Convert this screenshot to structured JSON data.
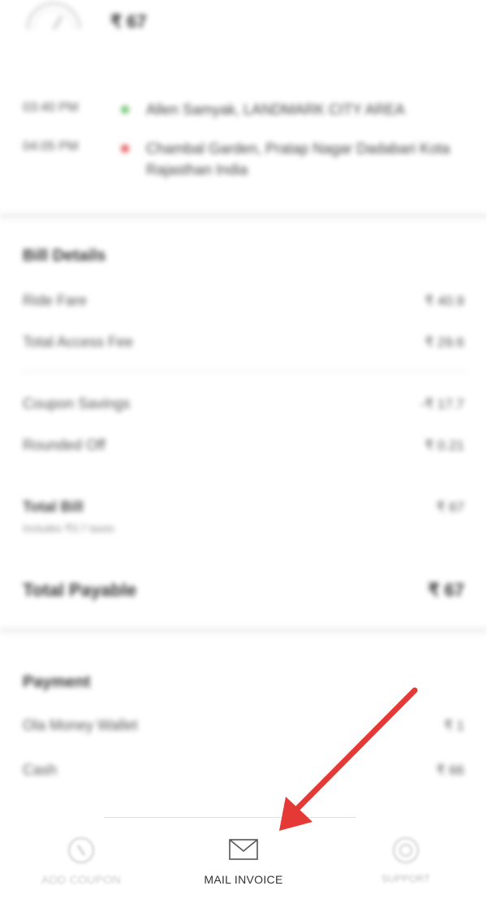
{
  "header": {
    "fare": "₹ 67"
  },
  "route": [
    {
      "time": "03:40 PM",
      "address": "Allen Samyak, LANDMARK CITY AREA",
      "marker": "green"
    },
    {
      "time": "04:05 PM",
      "address": "Chambal Garden, Pratap Nagar Dadabari Kota Rajasthan India",
      "marker": "red"
    }
  ],
  "bill": {
    "title": "Bill Details",
    "rows": [
      {
        "label": "Ride Fare",
        "value": "₹ 40.9"
      },
      {
        "label": "Total Access Fee",
        "value": "₹ 29.6"
      }
    ],
    "adjustments": [
      {
        "label": "Coupon Savings",
        "value": "-₹ 17.7"
      },
      {
        "label": "Rounded Off",
        "value": "₹ 0.21"
      }
    ],
    "total_bill": {
      "label": "Total Bill",
      "sub": "Includes ₹3.7 taxes",
      "value": "₹ 67"
    },
    "total_payable": {
      "label": "Total Payable",
      "value": "₹ 67"
    }
  },
  "payment": {
    "title": "Payment",
    "rows": [
      {
        "label": "Ola Money Wallet",
        "value": "₹ 1"
      },
      {
        "label": "Cash",
        "value": "₹ 66"
      }
    ]
  },
  "bottom_nav": {
    "coupon_label": "ADD COUPON",
    "mail_label": "MAIL INVOICE",
    "support_label": "SUPPORT"
  },
  "colors": {
    "arrow": "#e53935",
    "pickup_marker": "#6ec36e",
    "drop_marker": "#e35a5a"
  }
}
